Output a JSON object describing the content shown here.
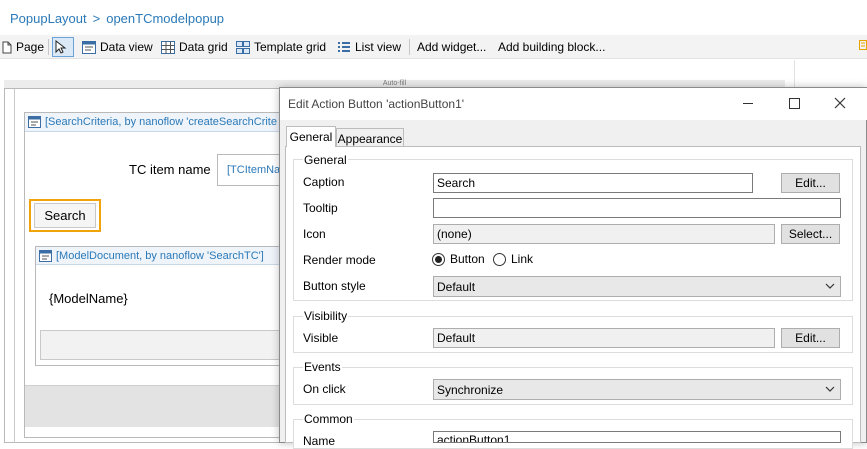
{
  "breadcrumb": [
    "PopupLayout",
    ">",
    "openTCmodelpopup"
  ],
  "toolbar": {
    "page": "Page",
    "data_view": "Data view",
    "data_grid": "Data grid",
    "template_grid": "Template grid",
    "list_view": "List view",
    "add_widget": "Add widget...",
    "add_building_block": "Add building block..."
  },
  "canvas": {
    "autofill_label": "Auto-fill",
    "dataview1_header": "[SearchCriteria, by nanoflow 'createSearchCrite",
    "tc_item_label": "TC item name",
    "tc_item_input": "[TCItemNa",
    "search_button": "Search",
    "dataview2_header": "[ModelDocument, by nanoflow 'SearchTC']",
    "model_name": "{ModelName}"
  },
  "dialog": {
    "title": "Edit Action Button 'actionButton1'",
    "tabs": [
      "General",
      "Appearance"
    ],
    "active_tab": "General",
    "general": {
      "heading": "General",
      "caption_label": "Caption",
      "caption_value": "Search",
      "caption_edit": "Edit...",
      "tooltip_label": "Tooltip",
      "tooltip_value": "",
      "icon_label": "Icon",
      "icon_value": "(none)",
      "icon_select": "Select...",
      "render_mode_label": "Render mode",
      "render_mode_options": [
        "Button",
        "Link"
      ],
      "render_mode_selected": "Button",
      "button_style_label": "Button style",
      "button_style_value": "Default"
    },
    "visibility": {
      "heading": "Visibility",
      "visible_label": "Visible",
      "visible_value": "Default",
      "visible_edit": "Edit..."
    },
    "events": {
      "heading": "Events",
      "on_click_label": "On click",
      "on_click_value": "Synchronize"
    },
    "common": {
      "heading": "Common",
      "name_label": "Name",
      "name_value": "actionButton1"
    }
  },
  "colors": {
    "accent": "#2b79b8",
    "highlight": "#f0a30a"
  }
}
